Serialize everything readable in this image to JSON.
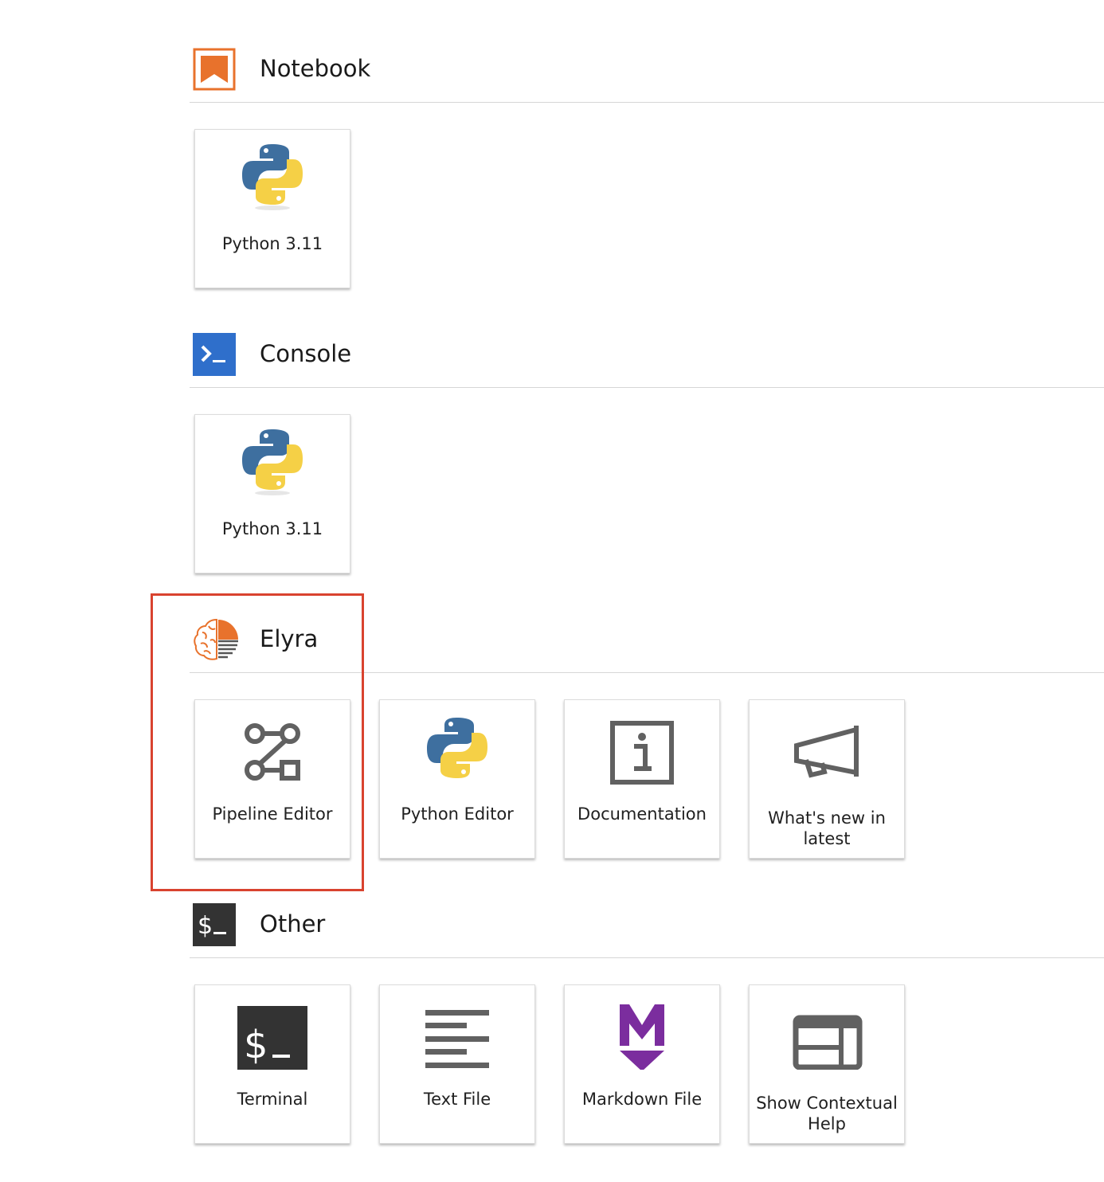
{
  "sections": [
    {
      "title": "Notebook",
      "icon": "notebook-icon",
      "color": "#e8722c",
      "cards": [
        {
          "label": "Python 3.11",
          "icon": "python-icon"
        }
      ]
    },
    {
      "title": "Console",
      "icon": "console-icon",
      "color": "#2f6fcb",
      "cards": [
        {
          "label": "Python 3.11",
          "icon": "python-icon"
        }
      ]
    },
    {
      "title": "Elyra",
      "icon": "elyra-brain-icon",
      "color": "#e8722c",
      "cards": [
        {
          "label": "Pipeline Editor",
          "icon": "pipeline-icon"
        },
        {
          "label": "Python Editor",
          "icon": "python-icon"
        },
        {
          "label": "Documentation",
          "icon": "info-icon"
        },
        {
          "label": "What's new in latest",
          "icon": "megaphone-icon"
        }
      ]
    },
    {
      "title": "Other",
      "icon": "terminal-small-icon",
      "color": "#333333",
      "cards": [
        {
          "label": "Terminal",
          "icon": "terminal-icon"
        },
        {
          "label": "Text File",
          "icon": "text-file-icon"
        },
        {
          "label": "Markdown File",
          "icon": "markdown-icon"
        },
        {
          "label": "Show Contextual Help",
          "icon": "contextual-help-icon"
        }
      ]
    }
  ],
  "highlight": {
    "color": "#d9432f",
    "target": "Pipeline Editor"
  }
}
